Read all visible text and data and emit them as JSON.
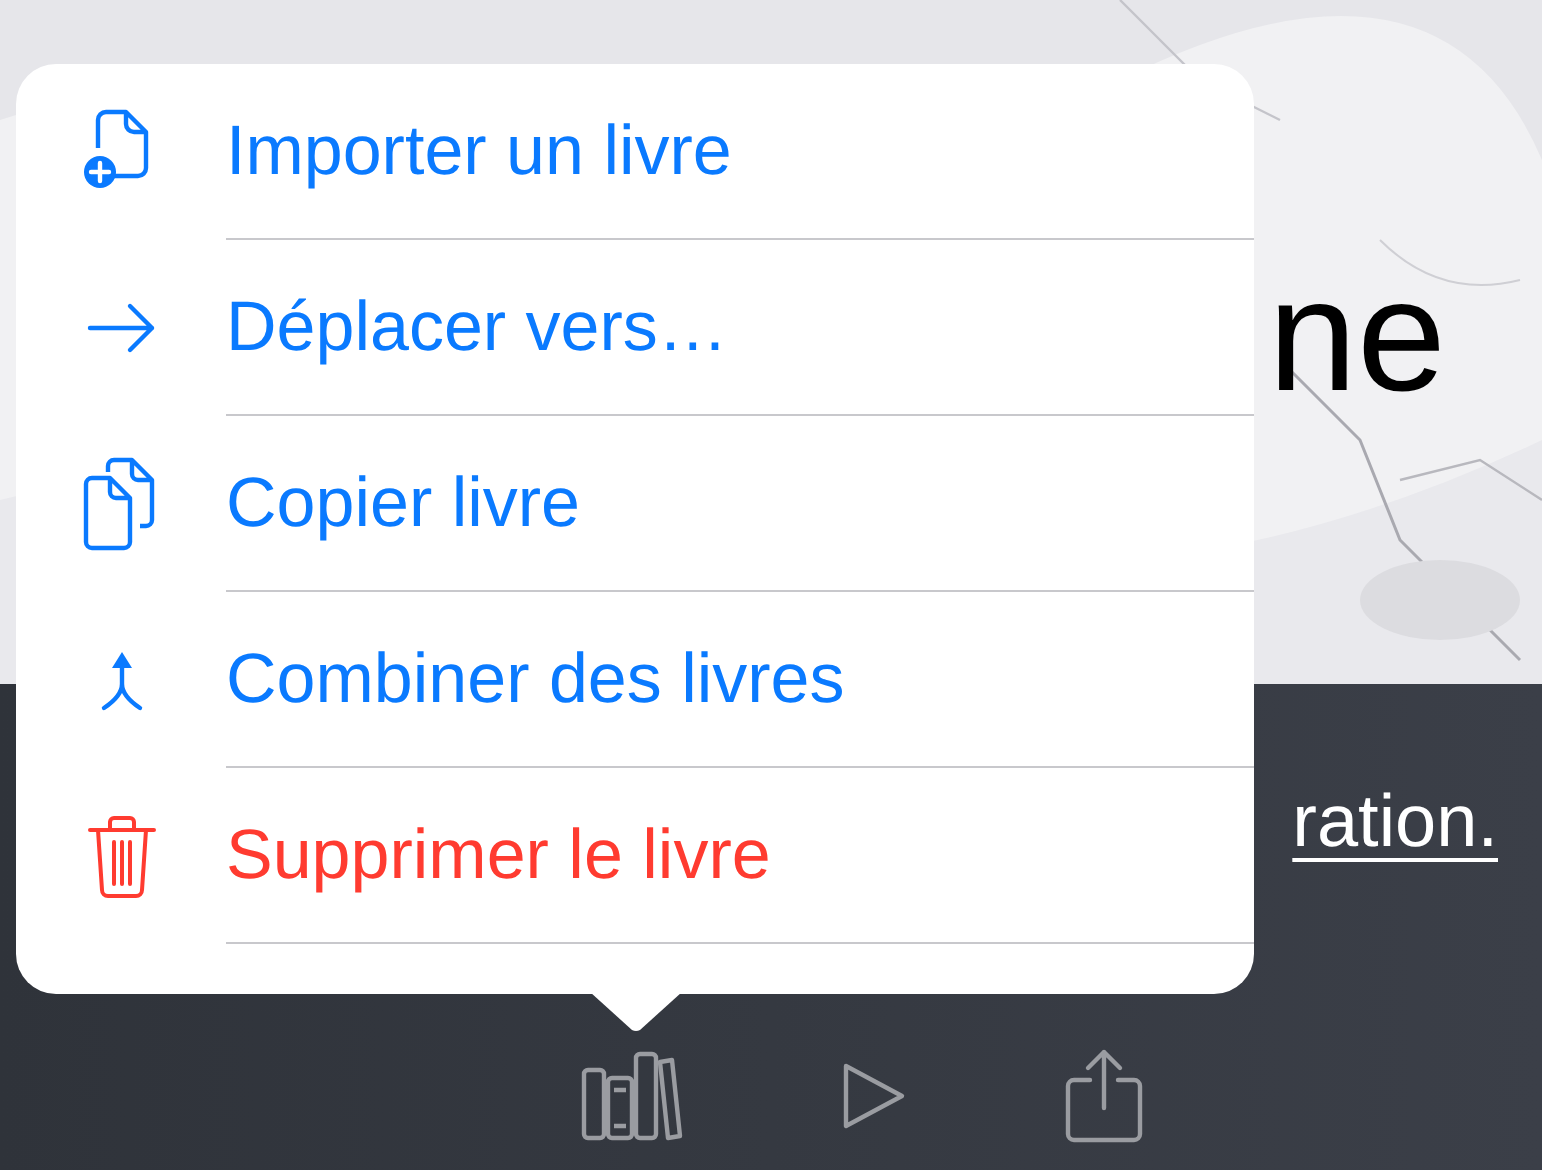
{
  "background": {
    "title": "ne",
    "link": "ration."
  },
  "menu": {
    "items": [
      {
        "label": "Importer un livre",
        "kind": "action"
      },
      {
        "label": "Déplacer vers…",
        "kind": "action"
      },
      {
        "label": "Copier livre",
        "kind": "action"
      },
      {
        "label": "Combiner des livres",
        "kind": "action"
      },
      {
        "label": "Supprimer le livre",
        "kind": "destructive"
      }
    ]
  }
}
